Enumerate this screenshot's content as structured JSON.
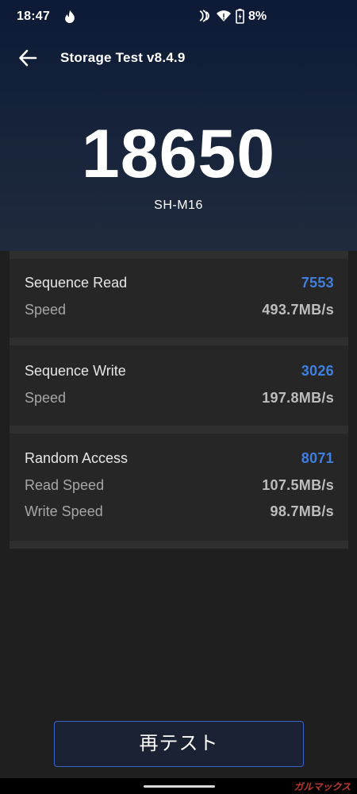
{
  "status_bar": {
    "time": "18:47",
    "battery": "8%"
  },
  "app_bar": {
    "title": "Storage Test v8.4.9"
  },
  "summary": {
    "score": "18650",
    "device": "SH-M16"
  },
  "results": [
    {
      "title": "Sequence Read",
      "score": "7553",
      "rows": [
        {
          "label": "Speed",
          "value": "493.7MB/s"
        }
      ]
    },
    {
      "title": "Sequence Write",
      "score": "3026",
      "rows": [
        {
          "label": "Speed",
          "value": "197.8MB/s"
        }
      ]
    },
    {
      "title": "Random Access",
      "score": "8071",
      "rows": [
        {
          "label": "Read Speed",
          "value": "107.5MB/s"
        },
        {
          "label": "Write Speed",
          "value": "98.7MB/s"
        }
      ]
    }
  ],
  "actions": {
    "retest_label": "再テスト"
  },
  "watermark": "ガルマックス",
  "colors": {
    "header_top": "#0d1a36",
    "background": "#1f1f1f",
    "card": "#262626",
    "score_accent": "#3f7fe0",
    "button_border": "#3a64c8"
  },
  "icons": {
    "back": "arrow-left-icon",
    "status": [
      "flame-drop-icon",
      "nfc-icon",
      "wifi-icon",
      "battery-icon"
    ]
  }
}
